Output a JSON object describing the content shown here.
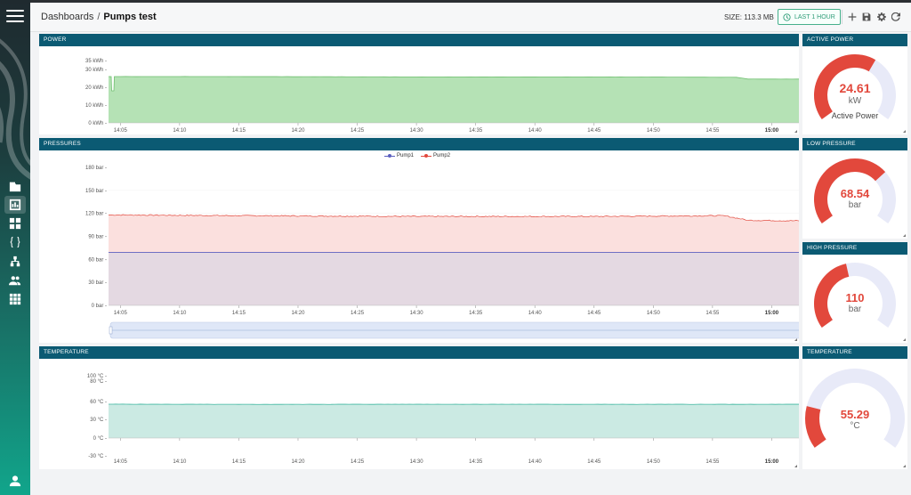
{
  "colors": {
    "panel_header": "#0b5a73",
    "power_fill": "#b5e2b5",
    "power_line": "#6fbf6f",
    "pump1": "#5b5fbf",
    "pump2": "#e2483c",
    "temperature_fill": "#cbeae3",
    "temperature_line": "#3fb7a0",
    "gauge_value": "#e2483c",
    "gauge_track": "#e8eaf8",
    "accent_green": "#2f9c78"
  },
  "sidebar": {
    "items": [
      {
        "icon": "menu-icon"
      },
      {
        "icon": "building-icon"
      },
      {
        "icon": "dashboard-icon"
      },
      {
        "icon": "devices-icon"
      },
      {
        "icon": "code-braces-icon"
      },
      {
        "icon": "hierarchy-icon"
      },
      {
        "icon": "users-icon"
      },
      {
        "icon": "apps-grid-icon"
      },
      {
        "icon": "user-account-icon"
      }
    ]
  },
  "header": {
    "breadcrumb_root": "Dashboards",
    "breadcrumb_sep": "/",
    "title": "Pumps test",
    "size_text": "SIZE: 113.3 MB",
    "time_range": "LAST 1 HOUR",
    "tools": [
      "add-icon",
      "save-icon",
      "settings-icon",
      "refresh-icon"
    ]
  },
  "x_ticks": [
    "14:05",
    "14:10",
    "14:15",
    "14:20",
    "14:25",
    "14:30",
    "14:35",
    "14:40",
    "14:45",
    "14:50",
    "14:55",
    "15:00"
  ],
  "panels": {
    "power": {
      "title": "POWER",
      "y_ticks": [
        "35 kWh -",
        "30 kWh -",
        "20 kWh -",
        "10 kWh -",
        "0 kWh -"
      ]
    },
    "active_power": {
      "title": "ACTIVE POWER",
      "value": "24.61",
      "unit": "kW",
      "label": "Active Power",
      "fraction": 0.62
    },
    "pressures": {
      "title": "PRESSURES",
      "y_ticks": [
        "180 bar -",
        "150 bar -",
        "120 bar -",
        "90 bar -",
        "60 bar -",
        "30 bar -",
        "0 bar -"
      ],
      "legend": [
        "Pump1",
        "Pump2"
      ]
    },
    "low_pressure": {
      "title": "LOW PRESSURE",
      "value": "68.54",
      "unit": "bar",
      "fraction": 0.69
    },
    "high_pressure": {
      "title": "HIGH PRESSURE",
      "value": "110",
      "unit": "bar",
      "fraction": 0.45
    },
    "temperature": {
      "title": "TEMPERATURE",
      "y_ticks": [
        "100 °C -",
        "80 °C -",
        "60 °C -",
        "30 °C -",
        "0 °C -",
        "-30 °C -"
      ]
    },
    "temperature_gauge": {
      "title": "TEMPERATURE",
      "value": "55.29",
      "unit": "°C",
      "fraction": 0.2
    }
  },
  "chart_data": [
    {
      "type": "area",
      "name": "POWER",
      "unit": "kWh",
      "x": [
        "14:04",
        "14:05",
        "14:15",
        "14:30",
        "14:45",
        "14:57",
        "14:58",
        "15:04"
      ],
      "values": [
        26,
        26,
        26,
        25.8,
        25.8,
        25.6,
        24.6,
        24.6
      ],
      "ylim": [
        0,
        35
      ]
    },
    {
      "type": "area",
      "name": "PRESSURES",
      "unit": "bar",
      "x": [
        "14:04",
        "14:15",
        "14:30",
        "14:45",
        "14:56",
        "14:58",
        "15:04"
      ],
      "series": [
        {
          "name": "Pump1",
          "values": [
            69,
            69,
            69,
            69,
            69,
            69,
            69
          ]
        },
        {
          "name": "Pump2",
          "values": [
            118,
            117,
            116,
            116,
            117,
            111,
            110
          ]
        }
      ],
      "ylim": [
        0,
        180
      ]
    },
    {
      "type": "area",
      "name": "TEMPERATURE",
      "unit": "°C",
      "x": [
        "14:04",
        "14:15",
        "14:30",
        "14:45",
        "15:03"
      ],
      "values": [
        55.5,
        55.2,
        55.4,
        55.3,
        55.3
      ],
      "ylim": [
        -30,
        100
      ]
    }
  ]
}
